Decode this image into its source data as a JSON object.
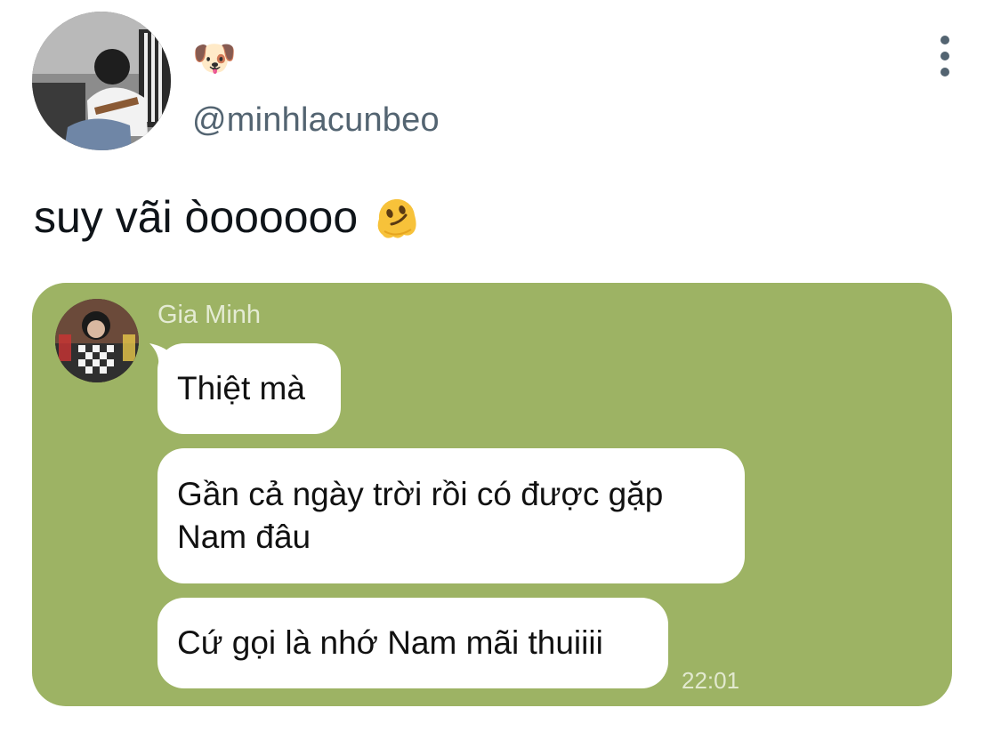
{
  "header": {
    "display_name_emoji": "🐶",
    "handle": "@minhlacunbeo",
    "more_icon": "vertical-dots-icon"
  },
  "tweet": {
    "text": "suy vãi òoooooo",
    "emoji_icon": "melting-face-icon"
  },
  "chat": {
    "background_color": "#9db364",
    "sender_name": "Gia Minh",
    "messages": [
      {
        "text": "Thiệt mà"
      },
      {
        "text": "Gần cả ngày trời rồi có được gặp Nam đâu"
      },
      {
        "text": "Cứ gọi là nhớ Nam mãi thuiiii"
      }
    ],
    "timestamp": "22:01"
  }
}
